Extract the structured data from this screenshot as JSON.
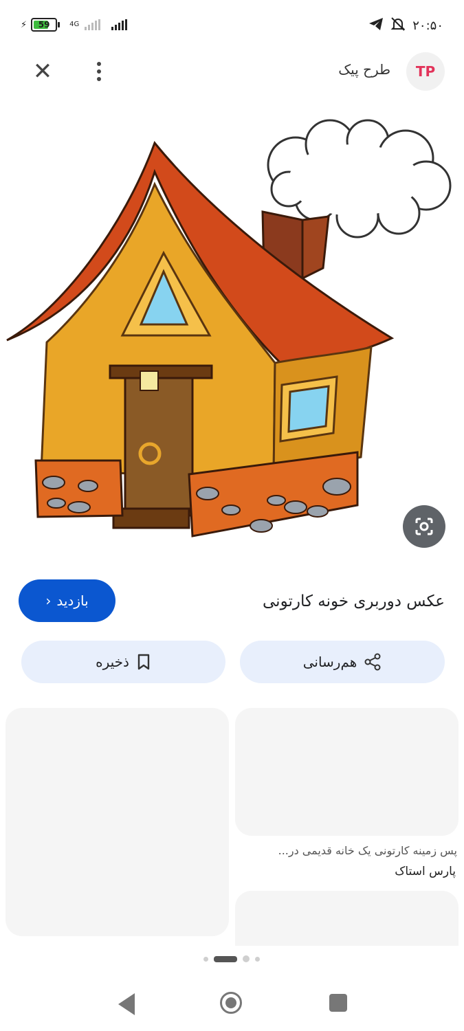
{
  "status_bar": {
    "battery": "59",
    "network": "4G",
    "time": "۲۰:۵۰"
  },
  "top_bar": {
    "site_name": "طرح پیک",
    "logo_text": "TP"
  },
  "image_result": {
    "title": "عکس دوربری خونه کارتونی",
    "visit_label": "بازدید"
  },
  "actions": {
    "share_label": "هم‌رسانی",
    "save_label": "ذخیره"
  },
  "related": {
    "caption": "پس زمینه کارتونی یک خانه قدیمی در...",
    "source": "پارس استاک"
  },
  "colors": {
    "accent": "#0b57d0",
    "pill": "#e8effc"
  }
}
